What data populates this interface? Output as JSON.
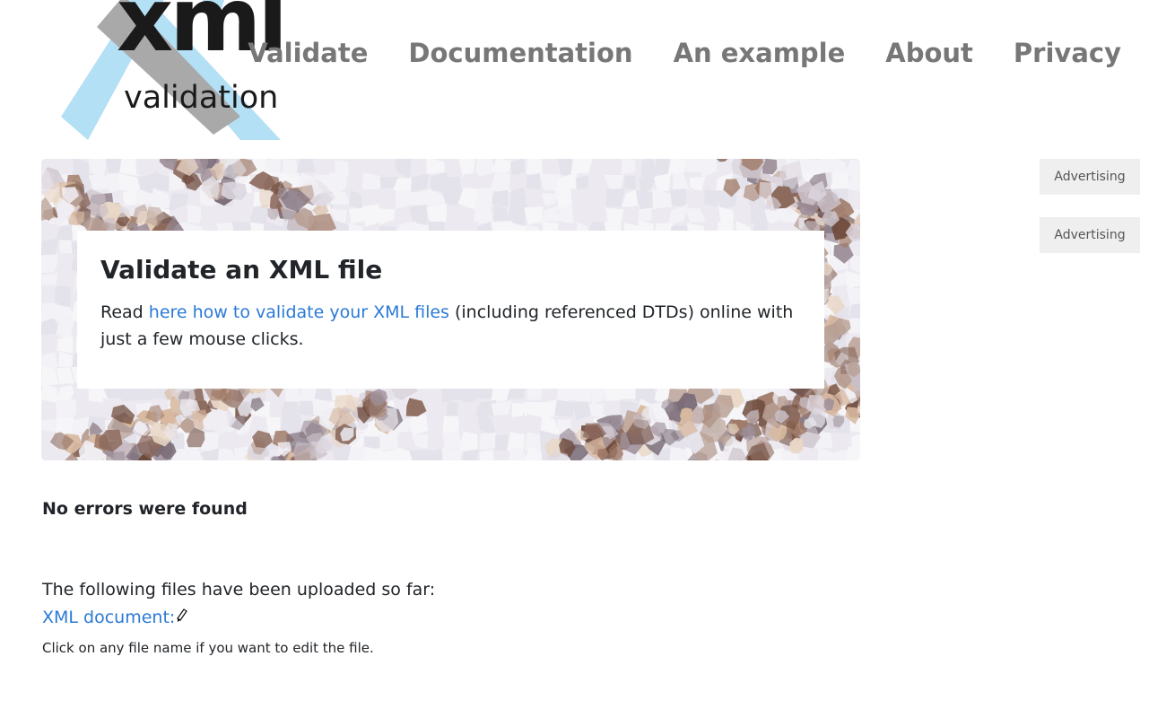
{
  "logo": {
    "main": "xml",
    "sub": "validation"
  },
  "nav": {
    "items": [
      {
        "label": "Validate"
      },
      {
        "label": "Documentation"
      },
      {
        "label": "An example"
      },
      {
        "label": "About"
      },
      {
        "label": "Privacy"
      }
    ]
  },
  "hero": {
    "title": "Validate an XML file",
    "text_before": "Read ",
    "link": "here how to validate your XML files",
    "text_after": " (including referenced DTDs) online with just a few mouse clicks."
  },
  "ads": [
    "Advertising",
    "Advertising"
  ],
  "result": {
    "status": "No errors were found"
  },
  "files": {
    "intro": "The following files have been uploaded so far:",
    "items": [
      {
        "name": "XML document:",
        "icon": "pencil-icon"
      }
    ],
    "hint": "Click on any file name if you want to edit the file."
  },
  "colors": {
    "link": "#2a7ad6",
    "nav": "#777777",
    "logo_cross_blue": "#b3e0f4",
    "logo_cross_gray": "#a9a9a9"
  }
}
